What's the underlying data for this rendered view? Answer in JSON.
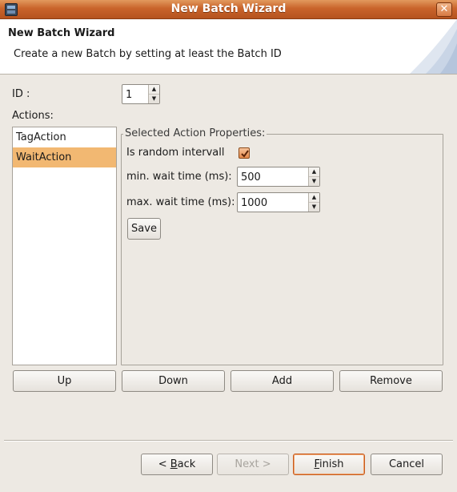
{
  "window": {
    "title": "New Batch Wizard",
    "close_glyph": "✕"
  },
  "header": {
    "title": "New Batch Wizard",
    "description": "Create a new Batch by setting at least the Batch ID"
  },
  "form": {
    "id_label": "ID :",
    "id_value": "1",
    "actions_label": "Actions:"
  },
  "actions": {
    "items": [
      {
        "label": "TagAction",
        "selected": false
      },
      {
        "label": "WaitAction",
        "selected": true
      }
    ]
  },
  "properties": {
    "legend": "Selected Action Properties:",
    "random_label": "Is random intervall",
    "random_checked": true,
    "min_label": "min. wait time (ms):",
    "min_value": "500",
    "max_label": "max. wait time (ms):",
    "max_value": "1000",
    "save_label": "Save"
  },
  "list_buttons": {
    "up": "Up",
    "down": "Down",
    "add": "Add",
    "remove": "Remove"
  },
  "footer": {
    "back_prefix": "< ",
    "back_mnemonic": "B",
    "back_rest": "ack",
    "next_label": "Next >",
    "finish_mnemonic": "F",
    "finish_rest": "inish",
    "cancel_label": "Cancel"
  },
  "colors": {
    "titlebar": "#c9642b",
    "selection": "#f2b872",
    "window_bg": "#ede9e3"
  }
}
